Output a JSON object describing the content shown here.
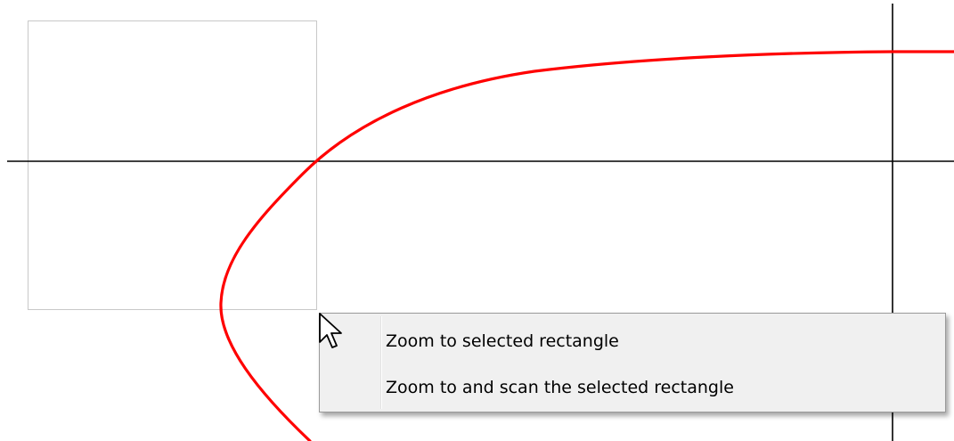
{
  "canvas": {
    "background": "#ffffff",
    "axis_color": "#000000",
    "curve_color": "#ff0000",
    "selection_rect_color": "#c8c8c8"
  },
  "context_menu": {
    "items": [
      {
        "label": "Zoom to selected rectangle"
      },
      {
        "label": "Zoom to and scan the selected rectangle"
      }
    ]
  },
  "cursor": {
    "icon": "arrow-pointer-icon"
  }
}
